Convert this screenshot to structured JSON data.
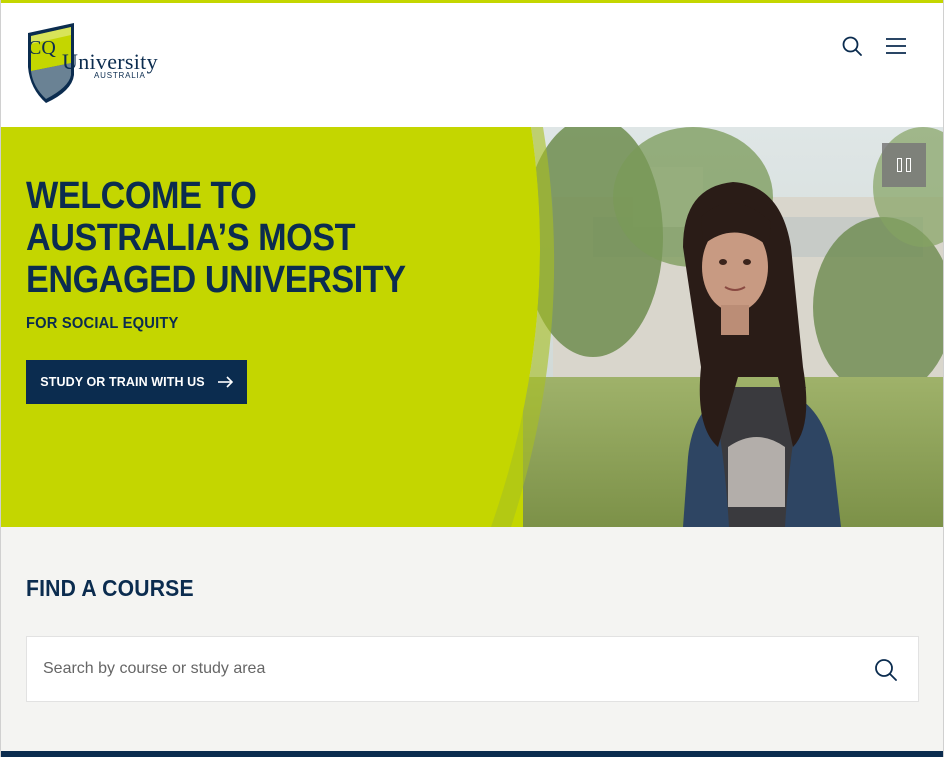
{
  "brand": {
    "logo_cq": "CQ",
    "logo_name": "University",
    "logo_country": "AUSTRALIA",
    "colors": {
      "navy": "#0b2c4f",
      "lime": "#c4d600",
      "grey_bg": "#f4f4f2"
    }
  },
  "header": {
    "icons": [
      "search-icon",
      "menu-icon"
    ]
  },
  "hero": {
    "title": "WELCOME TO AUSTRALIA’S MOST ENGAGED UNIVERSITY",
    "subtitle": "FOR SOCIAL EQUITY",
    "cta_label": "STUDY OR TRAIN WITH US",
    "pause_icon": "pause-icon"
  },
  "find_course": {
    "title": "FIND A COURSE",
    "search_placeholder": "Search by course or study area",
    "search_value": ""
  }
}
